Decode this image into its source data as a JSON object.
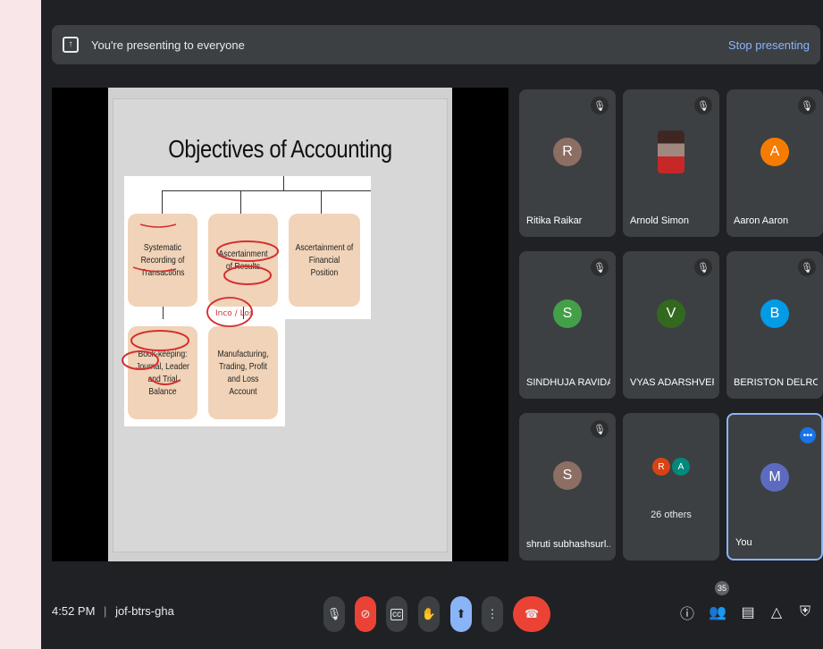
{
  "banner": {
    "text": "You're presenting to everyone",
    "stop_label": "Stop presenting",
    "icon": "present-to-all-icon"
  },
  "slide": {
    "title": "Objectives of Accounting",
    "boxes": [
      "Systematic Recording of Transactions",
      "Ascertainment of Results",
      "Ascertainment of Financial Position",
      "Book-keeping: Journal, Leader and Trial Balance",
      "Manufacturing, Trading, Profit and Loss Account"
    ],
    "annotation": "Inco / Los"
  },
  "participants": [
    {
      "name": "Ritika Raikar",
      "initial": "R",
      "color": "#8d6e63",
      "muted": true
    },
    {
      "name": "Arnold Simon",
      "initial": "",
      "color": "#5d4037",
      "muted": true,
      "photo": true
    },
    {
      "name": "Aaron Aaron",
      "initial": "A",
      "color": "#f57c00",
      "muted": true
    },
    {
      "name": "SINDHUJA RAVIDA...",
      "initial": "S",
      "color": "#43a047",
      "muted": true
    },
    {
      "name": "VYAS ADARSHVER...",
      "initial": "V",
      "color": "#33691e",
      "muted": true
    },
    {
      "name": "BERISTON DELROY...",
      "initial": "B",
      "color": "#039be5",
      "muted": true
    },
    {
      "name": "shruti subhashsurl...",
      "initial": "S",
      "color": "#8d6e63",
      "muted": true
    }
  ],
  "others": {
    "label": "26 others",
    "initials": [
      "R",
      "A"
    ],
    "colors": [
      "#d84315",
      "#00897b"
    ]
  },
  "self": {
    "name": "You",
    "initial": "M",
    "color": "#5c6bc0"
  },
  "footer": {
    "time": "4:52 PM",
    "meeting_code": "jof-btrs-gha",
    "participant_count": "35"
  },
  "colors": {
    "background": "#202124",
    "tile": "#3c4043",
    "accent": "#8ab4f8",
    "danger": "#ea4335"
  }
}
